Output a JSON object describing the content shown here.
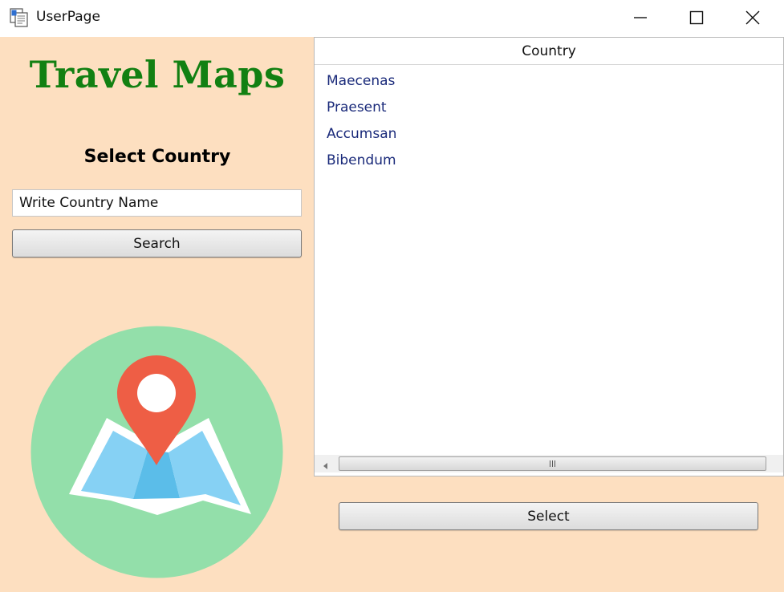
{
  "window": {
    "title": "UserPage",
    "controls": {
      "minimize": "minimize-icon",
      "maximize": "maximize-icon",
      "close": "close-icon"
    }
  },
  "left_panel": {
    "app_title": "Travel Maps",
    "subtitle": "Select Country",
    "search": {
      "value": "Write Country Name"
    },
    "search_button": "Search",
    "illustration": "map-pin-icon"
  },
  "country_list": {
    "header": "Country",
    "items": [
      "Maecenas",
      "Praesent",
      "Accumsan",
      "Bibendum"
    ]
  },
  "select_button": "Select",
  "colors": {
    "background": "#fddfc0",
    "title_green": "#128012",
    "list_text": "#1a2a7a",
    "circle": "#93dfaa",
    "pin": "#ee5e45",
    "map_blue": "#86d1f4"
  }
}
